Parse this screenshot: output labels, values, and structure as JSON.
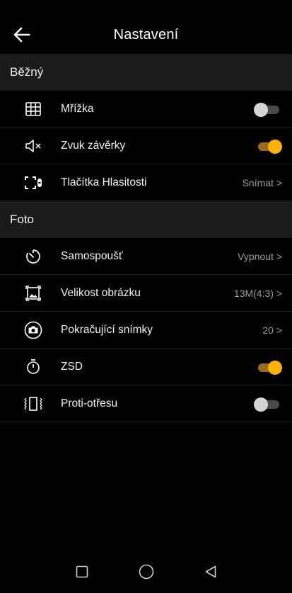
{
  "header": {
    "title": "Nastavení"
  },
  "sections": [
    {
      "title": "Běžný",
      "items": [
        {
          "label": "Mřížka",
          "icon": "grid-icon",
          "control": "toggle",
          "on": false
        },
        {
          "label": "Zvuk závěrky",
          "icon": "speaker-mute-icon",
          "control": "toggle",
          "on": true
        },
        {
          "label": "Tlačítka Hlasitosti",
          "icon": "volume-keys-icon",
          "control": "value",
          "value": "Snímat >"
        }
      ]
    },
    {
      "title": "Foto",
      "items": [
        {
          "label": "Samospoušť",
          "icon": "timer-icon",
          "control": "value",
          "value": "Vypnout >"
        },
        {
          "label": "Velikost obrázku",
          "icon": "image-size-icon",
          "control": "value",
          "value": "13M(4:3) >"
        },
        {
          "label": "Pokračující snímky",
          "icon": "burst-camera-icon",
          "control": "value",
          "value": "20 >"
        },
        {
          "label": "ZSD",
          "icon": "stopwatch-icon",
          "control": "toggle",
          "on": true
        },
        {
          "label": "Proti-otřesu",
          "icon": "anti-shake-icon",
          "control": "toggle",
          "on": false
        }
      ]
    }
  ],
  "colors": {
    "accent": "#ffb300",
    "accent_track": "#9a6c1c",
    "section_bg": "#1b1b1b",
    "value_text": "#9c9c9c"
  }
}
